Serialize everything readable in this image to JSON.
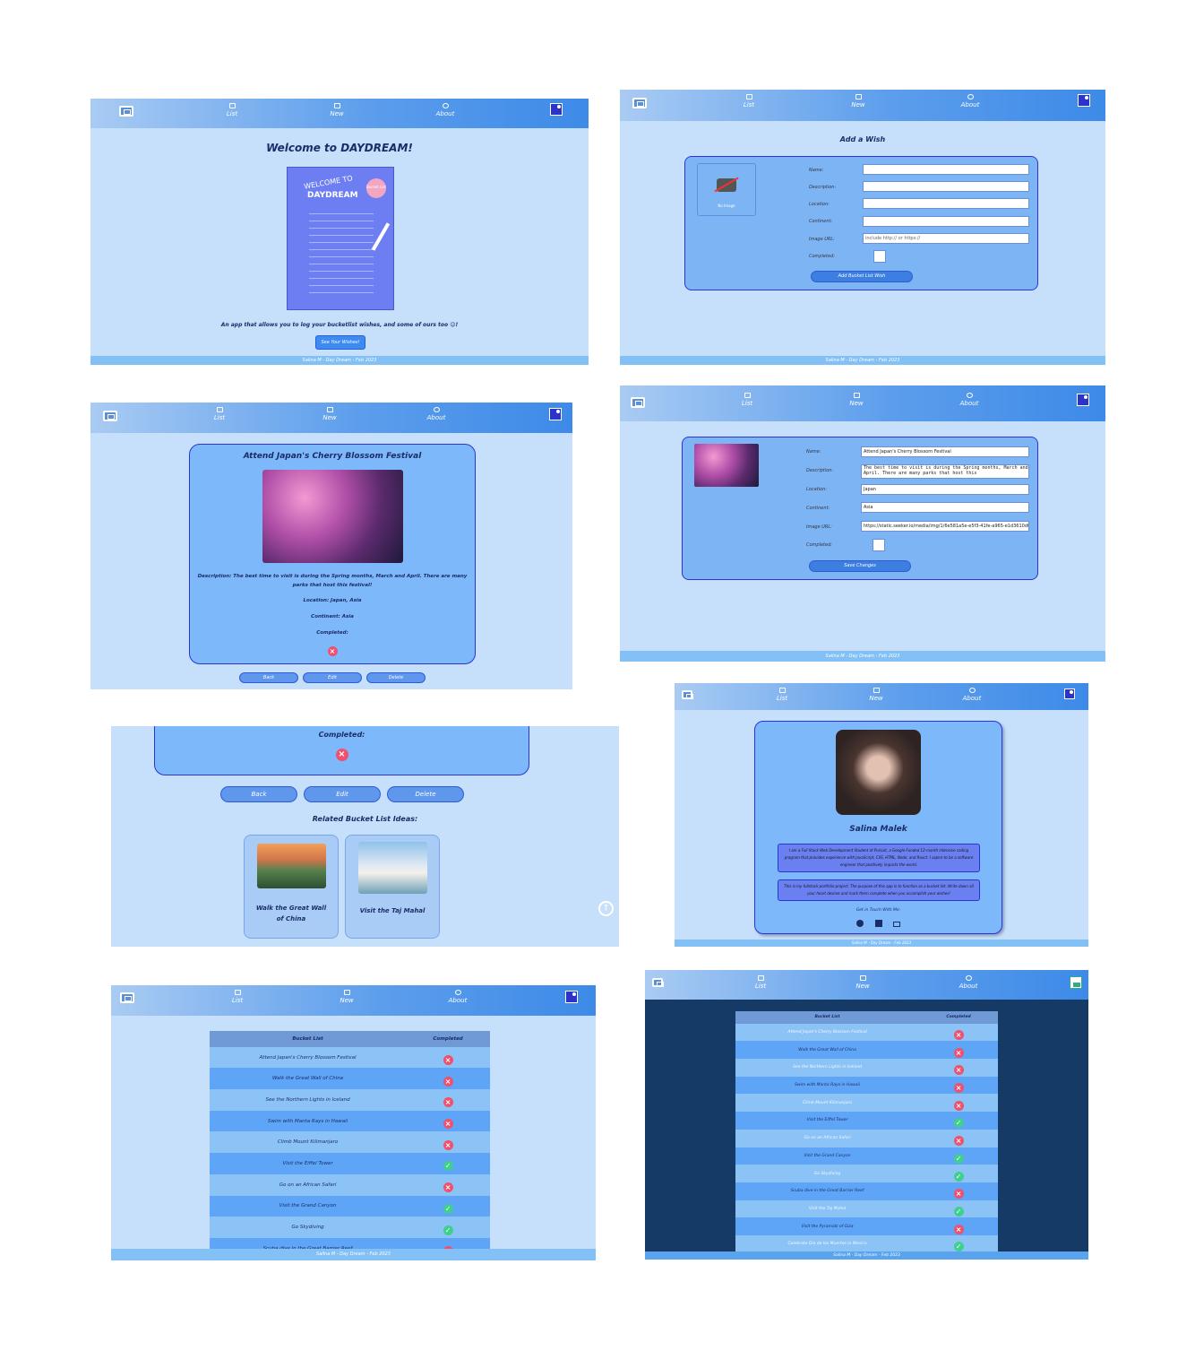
{
  "nav": {
    "list": "List",
    "new": "New",
    "about": "About"
  },
  "footer": "Salina M - Day Dream - Feb 2023",
  "home": {
    "title": "Welcome to DAYDREAM!",
    "poster_line1": "WELCOME TO",
    "poster_line2": "DAYDREAM",
    "poster_badge": "Bucket List",
    "tagline": "An app that allows you to log your bucketlist wishes, and some of ours too 😉!",
    "cta": "See Your Wishes!"
  },
  "add": {
    "title": "Add a Wish",
    "no_image": "No Image",
    "labels": [
      "Name:",
      "Description:",
      "Location:",
      "Continent:",
      "Image URL:",
      "Completed:"
    ],
    "url_placeholder": "include http:// or https://",
    "submit": "Add Bucket List Wish"
  },
  "detail": {
    "title": "Attend Japan's Cherry Blossom Festival",
    "description": "Description: The best time to visit is during the Spring months, March and April. There are many parks that host this festival!",
    "location": "Location: Japan, Asia",
    "continent": "Continent: Asia",
    "completed": "Completed:",
    "buttons": [
      "Back",
      "Edit",
      "Delete"
    ]
  },
  "edit": {
    "labels": [
      "Name:",
      "Description:",
      "Location:",
      "Continent:",
      "Image URL:",
      "Completed:"
    ],
    "name": "Attend Japan's Cherry Blossom Festival",
    "description": "The best time to visit is during the Spring months, March and April. There are many parks that host this",
    "location": "Japan",
    "continent": "Asia",
    "url": "https://static.seeker.io/media/img/1/6e581a5e-e5f3-41fe-a965-e1d3610d0c",
    "save": "Save Changes"
  },
  "related": {
    "completed": "Completed:",
    "buttons": [
      "Back",
      "Edit",
      "Delete"
    ],
    "heading": "Related Bucket List Ideas:",
    "cards": [
      "Walk the Great Wall of China",
      "Visit the Taj Mahal"
    ]
  },
  "about": {
    "name": "Salina Malek",
    "bio1": "I am a Full Stack Web Development Student at Pursuit, a Google-Funded 12-month intensive coding program that provides experience with JavaScript, CSS, HTML, Node, and React. I aspire to be a software engineer that positively impacts the world.",
    "bio2": "This is my fullstack portfolio project. The purpose of this app is to function as a bucket list. Write down all your heart desires and mark them complete when you accomplish your wishes!",
    "contact": "Get in Touch With Me:"
  },
  "list": {
    "col1": "Bucket List",
    "col2": "Completed",
    "rows": [
      {
        "name": "Attend Japan's Cherry Blossom Festival",
        "done": false
      },
      {
        "name": "Walk the Great Wall of China",
        "done": false
      },
      {
        "name": "See the Northern Lights in Iceland",
        "done": false
      },
      {
        "name": "Swim with Manta Rays in Hawaii",
        "done": false
      },
      {
        "name": "Climb Mount Kilimanjaro",
        "done": false
      },
      {
        "name": "Visit the Eiffel Tower",
        "done": true
      },
      {
        "name": "Go on an African Safari",
        "done": false
      },
      {
        "name": "Visit the Grand Canyon",
        "done": true
      },
      {
        "name": "Go Skydiving",
        "done": true
      },
      {
        "name": "Scuba dive in the Great Barrier Reef",
        "done": false
      },
      {
        "name": "Visit the Taj Mahal",
        "done": true
      },
      {
        "name": "Visit the Pyramids of Giza",
        "done": false
      },
      {
        "name": "Celebrate Día de los Muertos in Mexico",
        "done": true
      }
    ]
  },
  "colors": {
    "bg": "#c6e0fb",
    "nav": "#3d8ae8",
    "dark_bg": "#163a66",
    "x": "#f0506e",
    "check": "#3fcf8e"
  }
}
